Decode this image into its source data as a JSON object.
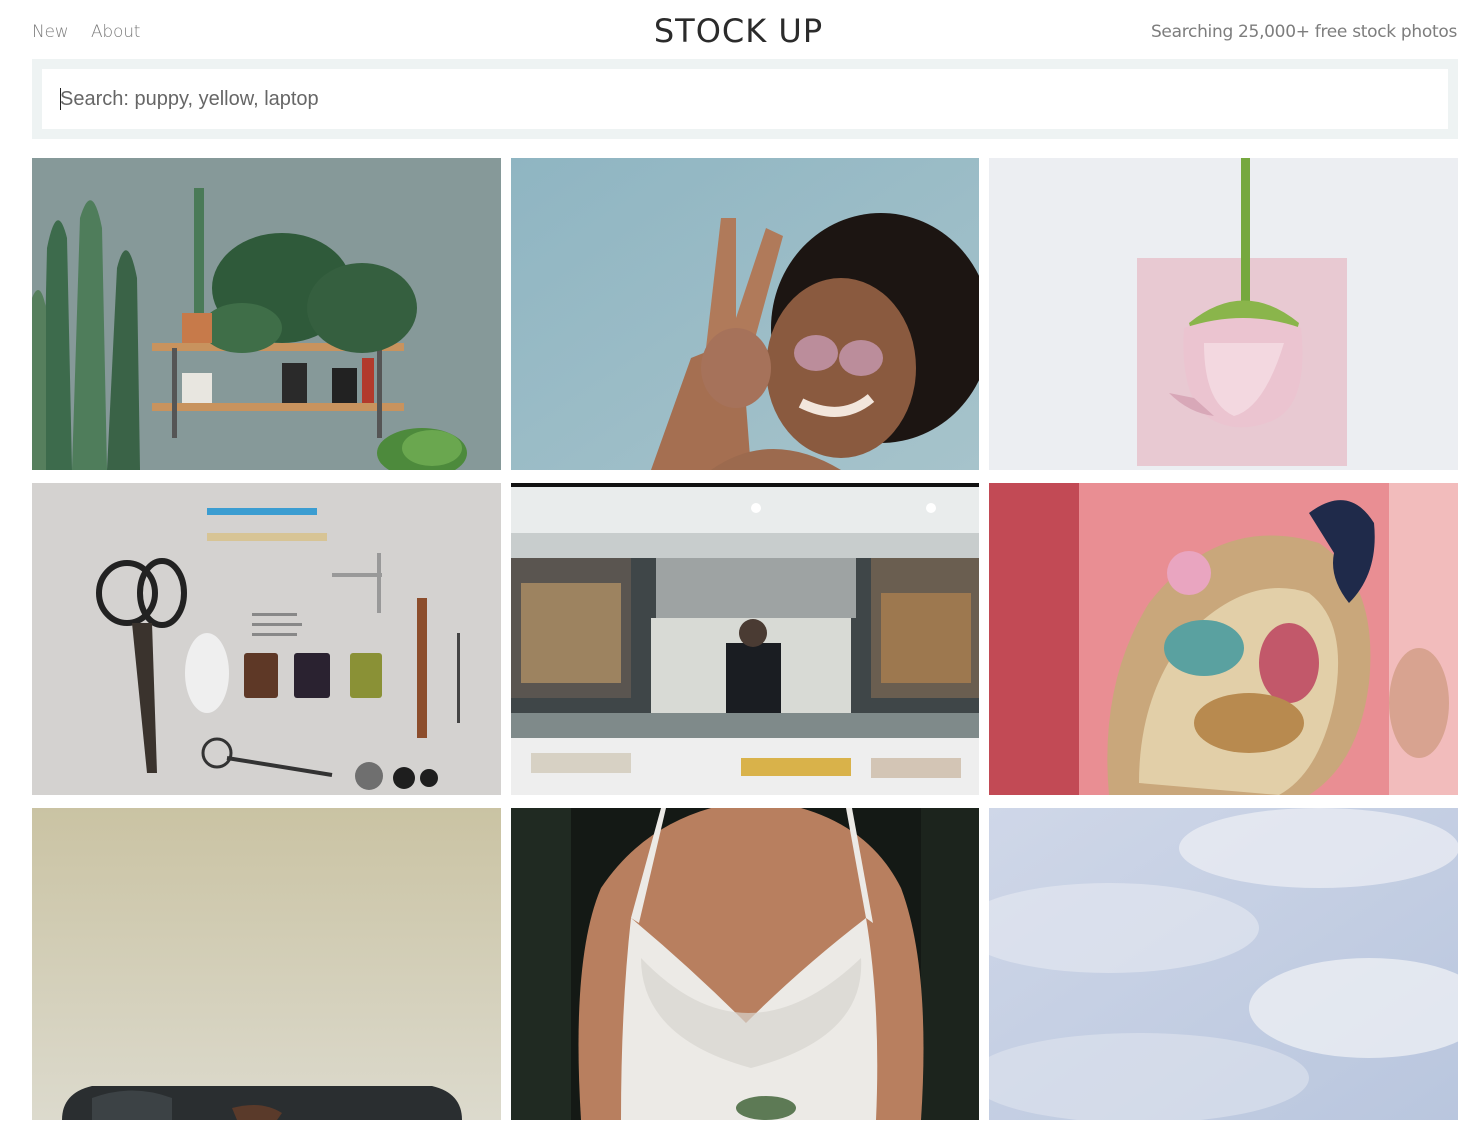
{
  "nav": {
    "new_label": "New",
    "about_label": "About"
  },
  "brand": {
    "title": "STOCK UP"
  },
  "tagline": "Searching 25,000+ free stock photos",
  "search": {
    "placeholder": "Search: puppy, yellow, laptop",
    "value": ""
  },
  "photos": [
    {
      "subject": "plants-on-shelf"
    },
    {
      "subject": "woman-peace-sign"
    },
    {
      "subject": "pink-rose"
    },
    {
      "subject": "sewing-tools"
    },
    {
      "subject": "restaurant-kitchen"
    },
    {
      "subject": "embroidered-fabric"
    },
    {
      "subject": "armchair"
    },
    {
      "subject": "bride-dress"
    },
    {
      "subject": "sky-clouds"
    }
  ]
}
